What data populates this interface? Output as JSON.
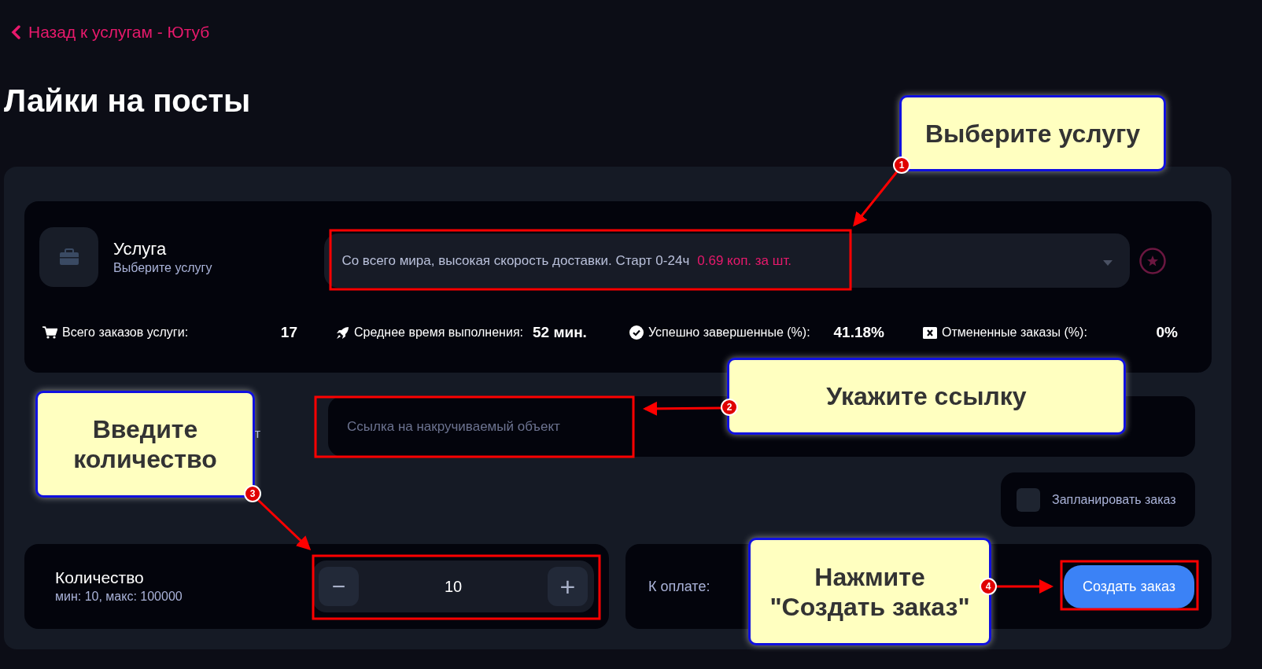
{
  "back_link": "Назад к услугам - Ютуб",
  "title": "Лайки на посты",
  "service": {
    "label": "Услуга",
    "hint": "Выберите услугу",
    "selected_text": "Со всего мира, высокая скорость доставки. Старт 0-24ч",
    "price": "0.69 коп. за шт."
  },
  "stats": [
    {
      "kind": "cart",
      "label": "Всего заказов услуги:",
      "value": "17"
    },
    {
      "kind": "rocket",
      "label": "Среднее время выполнения:",
      "value": "52 мин."
    },
    {
      "kind": "check",
      "label": "Успешно завершенные (%):",
      "value": "41.18%"
    },
    {
      "kind": "cancel",
      "label": "Отмененные заказы (%):",
      "value": "0%"
    }
  ],
  "link": {
    "label": "т",
    "placeholder": "Ссылка на накручиваемый объект"
  },
  "schedule": {
    "label": "Запланировать заказ",
    "checked": false
  },
  "quantity": {
    "label": "Количество",
    "hint": "мин: 10, макс: 100000",
    "value": "10",
    "decrement": "−",
    "increment": "+"
  },
  "payment": {
    "label": "К оплате:",
    "button": "Создать заказ"
  },
  "callouts": [
    {
      "number": "1",
      "text": "Выберите услугу"
    },
    {
      "number": "2",
      "text": "Укажите ссылку"
    },
    {
      "number": "3",
      "text": "Введите количество"
    },
    {
      "number": "4",
      "text": "Нажмите \"Создать заказ\""
    }
  ]
}
